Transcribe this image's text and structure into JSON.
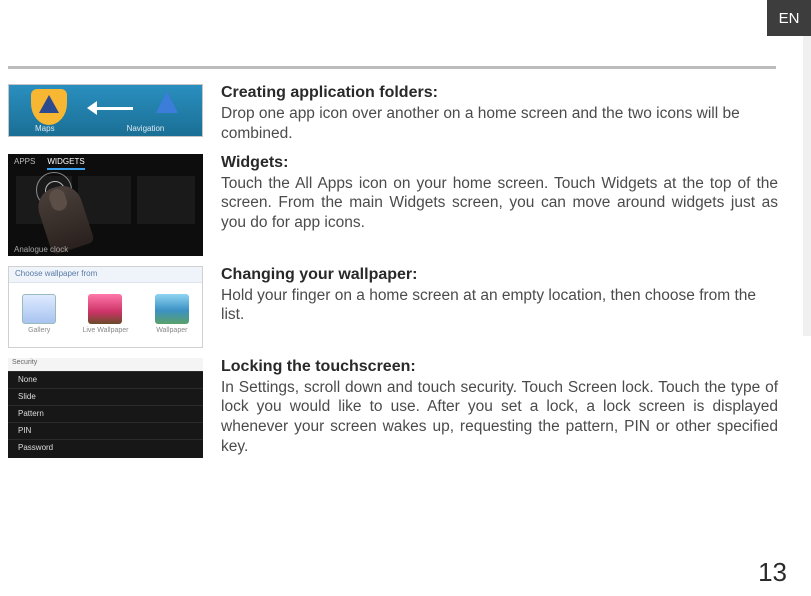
{
  "lang": "EN",
  "page_number": "13",
  "sections": [
    {
      "heading": "Creating application folders:",
      "body": "Drop one app icon over another on a home screen and the two icons will be combined.",
      "justify": false
    },
    {
      "heading": "Widgets:",
      "body": "Touch the All Apps icon on your home screen. Touch Widgets at the top of the screen. From the main Widgets screen, you can move around widgets just as you do for app icons.",
      "justify": true
    },
    {
      "heading": "Changing your wallpaper:",
      "body": "Hold your finger on a home screen at an empty location, then choose from the list.",
      "justify": false
    },
    {
      "heading": "Locking the touchscreen:",
      "body": "In Settings, scroll down and touch security. Touch Screen lock. Touch the type of lock you would like to use. After you set a lock, a lock screen is displayed whenever your screen wakes up, requesting the pattern, PIN or other specified key.",
      "justify": true
    }
  ],
  "thumb1": {
    "label_a": "Maps",
    "label_b": "Navigation"
  },
  "thumb2": {
    "tab_a": "APPS",
    "tab_b": "WIDGETS",
    "caption": "Analogue clock"
  },
  "thumb3": {
    "header": "Choose wallpaper from",
    "opts": [
      "Gallery",
      "Live Wallpaper",
      "Wallpaper"
    ]
  },
  "thumb4": {
    "header": "Security",
    "items": [
      "None",
      "Slide",
      "Pattern",
      "PIN",
      "Password"
    ]
  }
}
